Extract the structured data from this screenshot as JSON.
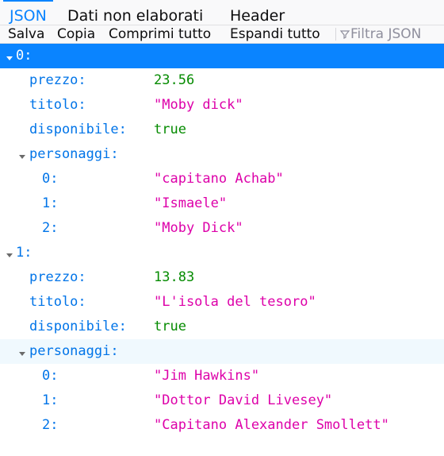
{
  "tabs": [
    "JSON",
    "Dati non elaborati",
    "Header"
  ],
  "toolbar": {
    "save": "Salva",
    "copy": "Copia",
    "collapse_all": "Comprimi tutto",
    "expand_all": "Espandi tutto",
    "filter_placeholder": "Filtra JSON"
  },
  "tree": {
    "item0": {
      "key": "0:",
      "prezzo_key": "prezzo:",
      "prezzo": "23.56",
      "titolo_key": "titolo:",
      "titolo": "\"Moby dick\"",
      "disp_key": "disponibile:",
      "disp": "true",
      "pers_key": "personaggi:",
      "pers": [
        {
          "key": "0:",
          "value": "\"capitano Achab\""
        },
        {
          "key": "1:",
          "value": "\"Ismaele\""
        },
        {
          "key": "2:",
          "value": "\"Moby Dick\""
        }
      ]
    },
    "item1": {
      "key": "1:",
      "prezzo_key": "prezzo:",
      "prezzo": "13.83",
      "titolo_key": "titolo:",
      "titolo": "\"L'isola del tesoro\"",
      "disp_key": "disponibile:",
      "disp": "true",
      "pers_key": "personaggi:",
      "pers": [
        {
          "key": "0:",
          "value": "\"Jim Hawkins\""
        },
        {
          "key": "1:",
          "value": "\"Dottor David Livesey\""
        },
        {
          "key": "2:",
          "value": "\"Capitano Alexander Smollett\""
        }
      ]
    }
  },
  "colors": {
    "accent": "#0a84ff",
    "key": "#0074e8",
    "string": "#dd00a9",
    "number": "#058b00"
  }
}
